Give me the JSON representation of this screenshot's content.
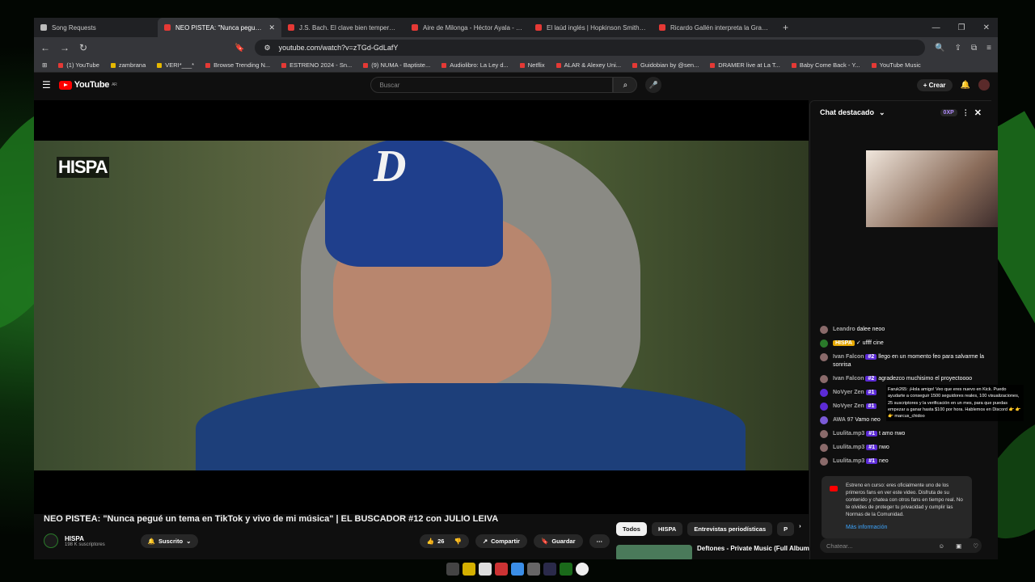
{
  "tabs": [
    {
      "label": "Song Requests",
      "active": false
    },
    {
      "label": "NEO PISTEA: \"Nunca pegué un",
      "active": true
    },
    {
      "label": "J.S. Bach. El clave bien temperado I.",
      "active": false
    },
    {
      "label": "Aire de Milonga - Héctor Ayala - Tab",
      "active": false
    },
    {
      "label": "El laúd inglés | Hopkinson Smith - Yo",
      "active": false
    },
    {
      "label": "Ricardo Gallén interpreta la Grande",
      "active": false
    }
  ],
  "address": {
    "url": "youtube.com/watch?v=zTGd-GdLafY"
  },
  "bookmarks": [
    "(1) YouTube",
    "zambrana",
    "VERI*___*",
    "Browse Trending N...",
    "ESTRENO 2024 - Sn...",
    "(9) NUMA - Baptiste...",
    "Audiolibro: La Ley d...",
    "Netflix",
    "ALAR & Alexey Uni...",
    "Guidobian by @sen...",
    "DRAMER live at La T...",
    "Baby Come Back - Y...",
    "YouTube Music"
  ],
  "youtube": {
    "logo": "YouTube",
    "region": "AR",
    "search_placeholder": "Buscar",
    "create_label": "Crear"
  },
  "video": {
    "overlay_logo": "HISPA",
    "title": "NEO PISTEA: \"Nunca pegué un tema en TikTok y vivo de mi música\" | EL BUSCADOR #12 con JULIO LEIVA",
    "channel": "HISPA",
    "subscribers": "198 K suscriptores",
    "subscribed_label": "Suscrito",
    "likes": "26",
    "share_label": "Compartir",
    "save_label": "Guardar"
  },
  "chips": [
    "Todos",
    "HISPA",
    "Entrevistas periodísticas",
    "P"
  ],
  "next_video": {
    "title": "Deftones - Private Music (Full Album)"
  },
  "chat": {
    "title": "Chat destacado",
    "xp": "0XP",
    "messages": [
      {
        "name": "Leandro",
        "badge": "",
        "text": "dalee neoo"
      },
      {
        "name": "HISPA",
        "badge": "",
        "text": "uffff cine",
        "owner": true
      },
      {
        "name": "Ivan Falcon",
        "badge": "#2",
        "text": "llego en un momento feo para salvarme la sonrisa"
      },
      {
        "name": "Ivan Falcon",
        "badge": "#2",
        "text": "agradezco muchisimo el proyectoooo"
      },
      {
        "name": "NoVyer Zen",
        "badge": "#1",
        "text": ""
      },
      {
        "name": "NoVyer Zen",
        "badge": "#1",
        "text": ""
      },
      {
        "name": "AWA 97",
        "badge": "",
        "text": "Vamo neo"
      },
      {
        "name": "Luulita.mp3",
        "badge": "#1",
        "text": "t amo nwo"
      },
      {
        "name": "Luulita.mp3",
        "badge": "#1",
        "text": "nwo"
      },
      {
        "name": "Luulita.mp3",
        "badge": "#1",
        "text": "neo"
      }
    ],
    "overlay_text": "Faruk265: ¡Hola amigo! Veo que eres nuevo en Kick. Puedo ayudarte a conseguir 1500 seguidores reales, 100 visualizaciones, 25 suscriptores y la verificación en un mes, para que puedas empezar a ganar hasta $100 por hora. Hablemos en Discord 👉 👉 👉 marcus_chidoo",
    "notice": "Estreno en curso: eres oficialmente uno de los primeros fans en ver este video. Disfruta de su contenido y chatea con otros fans en tiempo real. No te olvides de proteger tu privacidad y cumplir las Normas de la Comunidad.",
    "notice_link": "Más información",
    "input_placeholder": "Chatear..."
  }
}
